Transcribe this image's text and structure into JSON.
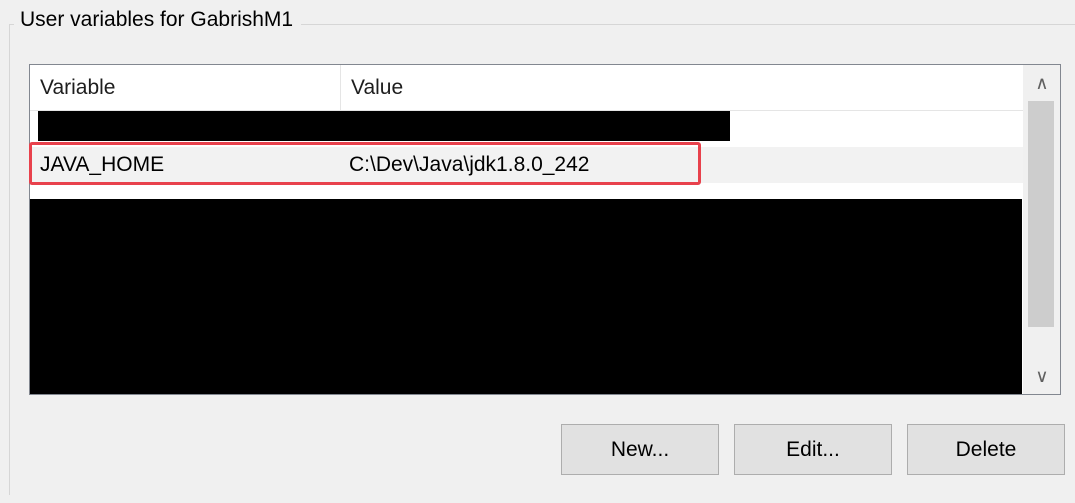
{
  "group": {
    "title": "User variables for GabrishM1"
  },
  "columns": {
    "variable": "Variable",
    "value": "Value"
  },
  "rows": [
    {
      "variable": "JAVA_HOME",
      "value": "C:\\Dev\\Java\\jdk1.8.0_242",
      "selected": true
    }
  ],
  "buttons": {
    "new": "New...",
    "edit": "Edit...",
    "delete": "Delete"
  },
  "scrollbar": {
    "up": "∧",
    "down": "∨"
  },
  "colors": {
    "highlight": "#e8414c",
    "selected_row": "#f2f2f2",
    "redaction": "#000000"
  }
}
